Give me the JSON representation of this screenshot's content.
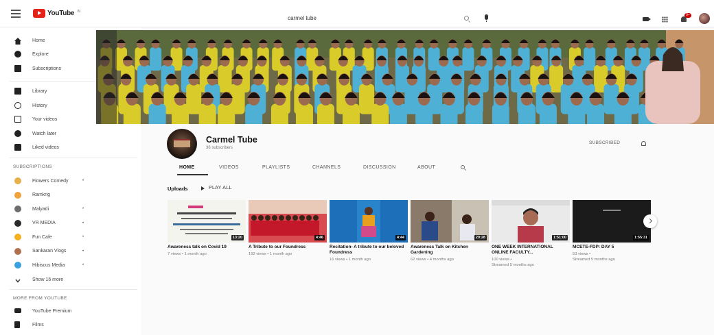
{
  "topbar": {
    "logo_text": "YouTube",
    "logo_country": "IN",
    "search_value": "carmel tube",
    "notification_count": "9+"
  },
  "sidebar": {
    "main": [
      {
        "label": "Home",
        "icon": "home-icon"
      },
      {
        "label": "Explore",
        "icon": "explore-icon"
      },
      {
        "label": "Subscriptions",
        "icon": "subscriptions-icon"
      }
    ],
    "library": [
      {
        "label": "Library",
        "icon": "library-icon"
      },
      {
        "label": "History",
        "icon": "history-icon"
      },
      {
        "label": "Your videos",
        "icon": "your-videos-icon"
      },
      {
        "label": "Watch later",
        "icon": "watch-later-icon"
      },
      {
        "label": "Liked videos",
        "icon": "liked-videos-icon"
      }
    ],
    "subscriptions_header": "SUBSCRIPTIONS",
    "subscriptions": [
      {
        "label": "Flowers Comedy",
        "color": "#e8b04a",
        "dot": "•"
      },
      {
        "label": "Ramkrig",
        "color": "#f2a23a",
        "dot": ""
      },
      {
        "label": "Malyadi",
        "color": "#6d6d6d",
        "dot": "•"
      },
      {
        "label": "VR MEDIA",
        "color": "#2a2a2a",
        "dot": "•"
      },
      {
        "label": "Fun Cafe",
        "color": "#f5b020",
        "dot": "•"
      },
      {
        "label": "Sankaran Vlogs",
        "color": "#b07050",
        "dot": "•"
      },
      {
        "label": "Hibiscus Media",
        "color": "#3aa0e0",
        "dot": "•"
      }
    ],
    "show_more": "Show 16 more",
    "more_header": "MORE FROM YOUTUBE",
    "more": [
      {
        "label": "YouTube Premium",
        "icon": "youtube-premium-icon"
      },
      {
        "label": "Films",
        "icon": "films-icon"
      }
    ]
  },
  "channel": {
    "name": "Carmel Tube",
    "subscribers": "36 subscribers",
    "subscribe_label": "SUBSCRIBED"
  },
  "tabs": [
    "HOME",
    "VIDEOS",
    "PLAYLISTS",
    "CHANNELS",
    "DISCUSSION",
    "ABOUT"
  ],
  "uploads": {
    "title": "Uploads",
    "play_all": "PLAY ALL",
    "videos": [
      {
        "title": "Awareness talk on Covid 19",
        "meta1": "7 views • 1 month ago",
        "meta2": "",
        "duration": "13:20",
        "theme": "white"
      },
      {
        "title": "A Tribute to our Foundress",
        "meta1": "192 views • 1 month ago",
        "meta2": "",
        "duration": "4:46",
        "theme": "red"
      },
      {
        "title": "Recitation- A tribute to our beloved Foundress",
        "meta1": "16 views • 1 month ago",
        "meta2": "",
        "duration": "4:44",
        "theme": "blue"
      },
      {
        "title": "Awareness Talk on Kitchen Gardening",
        "meta1": "62 views • 4 months ago",
        "meta2": "",
        "duration": "29:28",
        "theme": "room"
      },
      {
        "title": "ONE WEEK INTERNATIONAL ONLINE FACULTY...",
        "meta1": "100 views •",
        "meta2": "Streamed 5 months ago",
        "duration": "1:51:00",
        "theme": "person"
      },
      {
        "title": "MCETE-FDP: DAY 5",
        "meta1": "53 views •",
        "meta2": "Streamed 5 months ago",
        "duration": "1:55:31",
        "theme": "dark"
      }
    ]
  }
}
